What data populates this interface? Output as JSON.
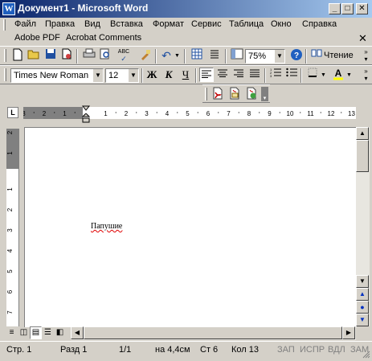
{
  "window": {
    "title": "Документ1 - Microsoft Word",
    "app_icon": "W"
  },
  "menu": [
    "Файл",
    "Правка",
    "Вид",
    "Вставка",
    "Формат",
    "Сервис",
    "Таблица",
    "Окно",
    "Справка"
  ],
  "menu2": [
    "Adobe PDF",
    "Acrobat Comments"
  ],
  "toolbar": {
    "zoom": "75%",
    "reading_label": "Чтение"
  },
  "format_toolbar": {
    "font": "Times New Roman",
    "size": "12",
    "bold": "Ж",
    "italic": "К",
    "underline": "Ч"
  },
  "ruler": {
    "h_ticks": [
      "3",
      "2",
      "1",
      "1",
      "2",
      "3",
      "4",
      "5",
      "6",
      "7",
      "8",
      "9",
      "10",
      "11",
      "12",
      "13"
    ],
    "v_ticks": [
      "2",
      "1",
      "1",
      "2",
      "3",
      "4",
      "5",
      "6",
      "7"
    ]
  },
  "document": {
    "text": "Папушие"
  },
  "status": {
    "page": "Стр. 1",
    "section": "Разд 1",
    "pages": "1/1",
    "at": "на 4,4см",
    "line": "Ст 6",
    "col": "Кол 13",
    "rec": "ЗАП",
    "trk": "ИСПР",
    "ext": "ВДЛ",
    "ovr": "ЗАМ"
  }
}
